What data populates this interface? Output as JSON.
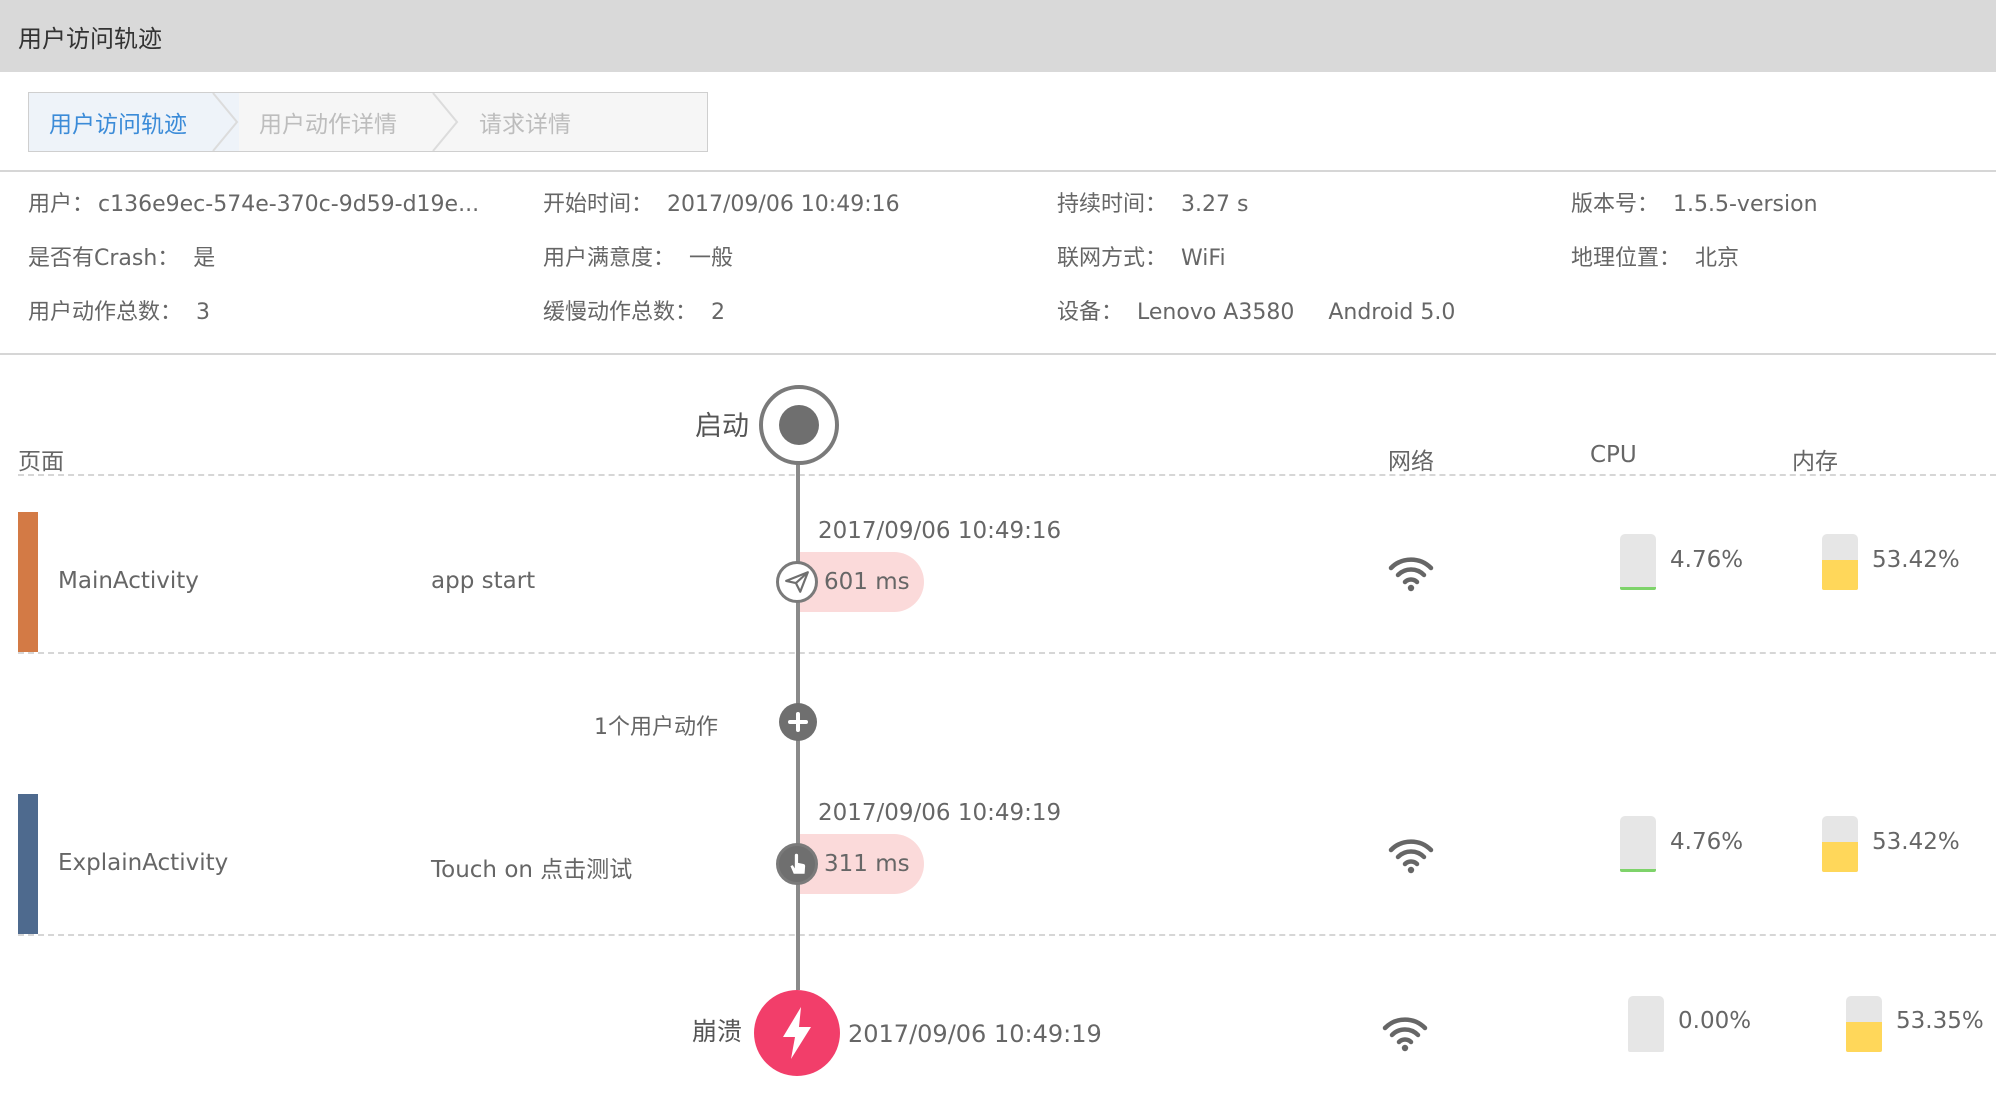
{
  "app": {
    "title": "用户访问轨迹"
  },
  "breadcrumb": [
    "用户访问轨迹",
    "用户动作详情",
    "请求详情"
  ],
  "info": {
    "user_label": "用户：",
    "user_value": "c136e9ec-574e-370c-9d59-d19e...",
    "start_label": "开始时间：",
    "start_value": "2017/09/06 10:49:16",
    "duration_label": "持续时间：",
    "duration_value": "3.27 s",
    "version_label": "版本号：",
    "version_value": "1.5.5-version",
    "crash_label": "是否有Crash：",
    "crash_value": "是",
    "satisfaction_label": "用户满意度：",
    "satisfaction_value": "一般",
    "network_label": "联网方式：",
    "network_value": "WiFi",
    "location_label": "地理位置：",
    "location_value": "北京",
    "actions_label": "用户动作总数：",
    "actions_value": "3",
    "slow_label": "缓慢动作总数：",
    "slow_value": "2",
    "device_label": "设备：",
    "device_value": "Lenovo A3580",
    "os_value": "Android 5.0"
  },
  "columns": {
    "page": "页面",
    "network": "网络",
    "cpu": "CPU",
    "memory": "内存"
  },
  "start": {
    "label": "启动"
  },
  "rows": [
    {
      "page": "MainActivity",
      "action": "app start",
      "time": "2017/09/06 10:49:16",
      "duration": "601 ms",
      "cpu": "4.76%",
      "cpu_level": 0.0476,
      "memory": "53.42%",
      "memory_level": 0.5342,
      "color": "#d37a45",
      "icon": "paper-plane-icon"
    },
    {
      "page": "ExplainActivity",
      "action": "Touch on 点击测试",
      "time": "2017/09/06 10:49:19",
      "duration": "311 ms",
      "cpu": "4.76%",
      "cpu_level": 0.0476,
      "memory": "53.42%",
      "memory_level": 0.5342,
      "color": "#4e6a8e",
      "icon": "hand-pointer-icon"
    }
  ],
  "collapsed": {
    "label": "1个用户动作"
  },
  "crash": {
    "label": "崩溃",
    "time": "2017/09/06 10:49:19",
    "cpu": "0.00%",
    "cpu_level": 0.0,
    "memory": "53.35%",
    "memory_level": 0.5335,
    "color": "#f23e6a"
  },
  "colors": {
    "cpu_fill": "#7ed36a",
    "memory_fill": "#ffd75a",
    "breadcrumb_active": "#3b8bd8"
  }
}
